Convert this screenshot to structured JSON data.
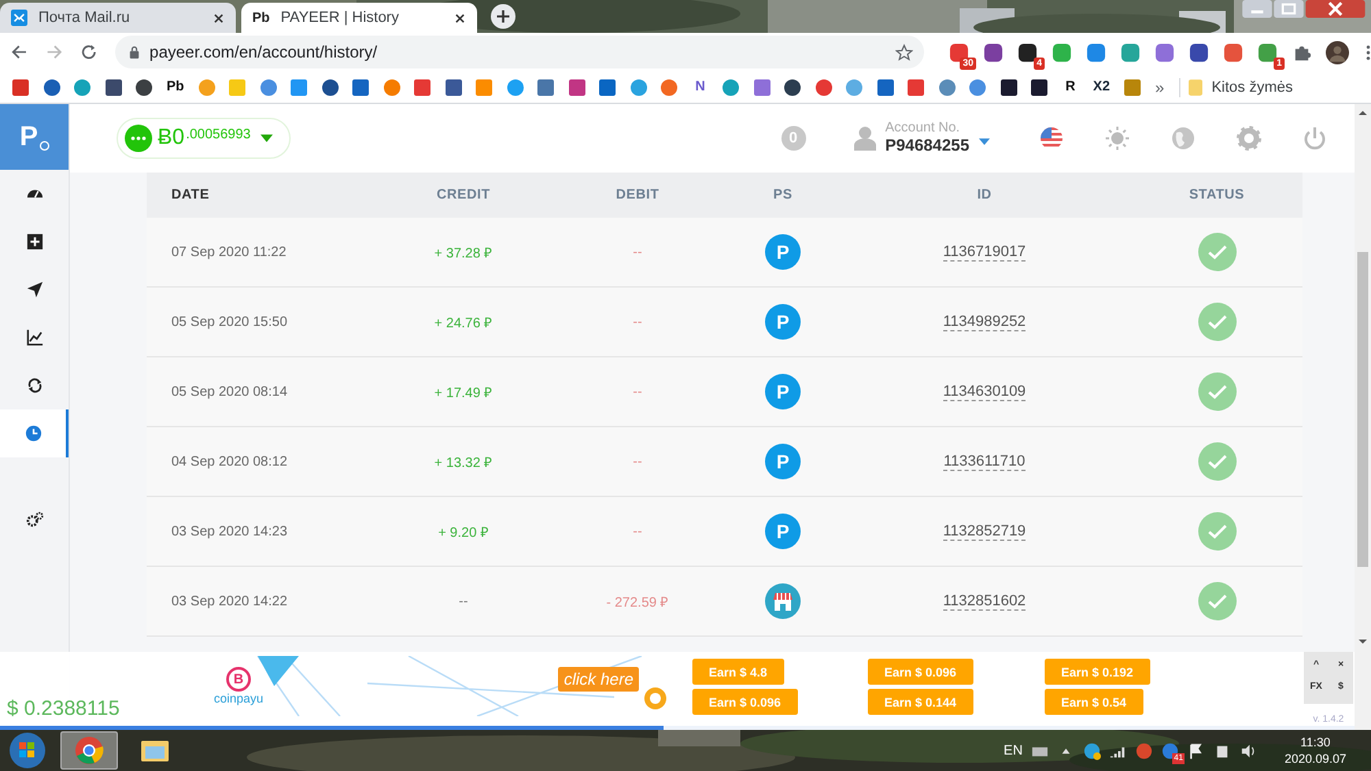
{
  "browser": {
    "tabs": [
      {
        "title": "Почта Mail.ru",
        "selected": false
      },
      {
        "title": "PAYEER | History",
        "icon_text": "Pb",
        "selected": true
      }
    ],
    "url": "payeer.com/en/account/history/",
    "extensions": [
      {
        "color": "#e53935",
        "badge": "30"
      },
      {
        "color": "#7b3fa0"
      },
      {
        "color": "#222222",
        "badge": "4"
      },
      {
        "color": "#2eb34a"
      },
      {
        "color": "#1e88e5"
      },
      {
        "color": "#26a69a"
      },
      {
        "color": "#8e6fd8"
      },
      {
        "color": "#3949ab"
      },
      {
        "color": "#e5533d"
      },
      {
        "color": "#43a047",
        "badge": "1"
      }
    ],
    "bookmarks": [
      {
        "color": "#d93025",
        "kind": "square"
      },
      {
        "color": "#1a5fb4",
        "kind": "circle"
      },
      {
        "color": "#16a3b8",
        "kind": "circle"
      },
      {
        "color": "#3c4a6b",
        "kind": "square"
      },
      {
        "color": "#3c4043",
        "kind": "circle"
      },
      {
        "color": "#111111",
        "kind": "text",
        "text": "Pb"
      },
      {
        "color": "#f4a11d",
        "kind": "circle"
      },
      {
        "color": "#f6c915",
        "kind": "square"
      },
      {
        "color": "#4a8fe0",
        "kind": "circle"
      },
      {
        "color": "#2196f3",
        "kind": "square"
      },
      {
        "color": "#1d4f91",
        "kind": "circle"
      },
      {
        "color": "#1565c0",
        "kind": "square"
      },
      {
        "color": "#f57c00",
        "kind": "circle"
      },
      {
        "color": "#e53935",
        "kind": "square"
      },
      {
        "color": "#3b5998",
        "kind": "square"
      },
      {
        "color": "#fb8c00",
        "kind": "square"
      },
      {
        "color": "#1da1f2",
        "kind": "circle"
      },
      {
        "color": "#4a76a8",
        "kind": "square"
      },
      {
        "color": "#c13584",
        "kind": "square"
      },
      {
        "color": "#0a66c2",
        "kind": "square"
      },
      {
        "color": "#2aa3df",
        "kind": "circle"
      },
      {
        "color": "#f26822",
        "kind": "circle"
      },
      {
        "color": "#6a5acd",
        "kind": "text",
        "text": "N"
      },
      {
        "color": "#16a3b8",
        "kind": "circle"
      },
      {
        "color": "#8e6fd8",
        "kind": "square"
      },
      {
        "color": "#2c3e50",
        "kind": "circle"
      },
      {
        "color": "#e53935",
        "kind": "circle"
      },
      {
        "color": "#5dade2",
        "kind": "circle"
      },
      {
        "color": "#1565c0",
        "kind": "square"
      },
      {
        "color": "#e53935",
        "kind": "square"
      },
      {
        "color": "#5b8db8",
        "kind": "circle"
      },
      {
        "color": "#4a8fe0",
        "kind": "circle"
      },
      {
        "color": "#1b1b2f",
        "kind": "square"
      },
      {
        "color": "#1b1b2f",
        "kind": "square"
      },
      {
        "color": "#111111",
        "kind": "text",
        "text": "R"
      },
      {
        "color": "#1b2838",
        "kind": "text",
        "text": "X2"
      },
      {
        "color": "#b8860b",
        "kind": "square"
      }
    ],
    "bookmarks_more": "»",
    "other_bookmarks": "Kitos žymės"
  },
  "sidebar": {
    "logo": "P",
    "items": [
      {
        "kind": "dashboard",
        "selected": false
      },
      {
        "kind": "add",
        "selected": false
      },
      {
        "kind": "send",
        "selected": false
      },
      {
        "kind": "chart",
        "selected": false
      },
      {
        "kind": "exchange",
        "selected": false
      },
      {
        "kind": "history",
        "selected": true
      },
      {
        "kind": "settings",
        "selected": false
      }
    ]
  },
  "header": {
    "balance_main": "Ƀ0",
    "balance_fraction": ".00056993",
    "notifications": "0",
    "account_label": "Account No.",
    "account_number": "P94684255"
  },
  "table": {
    "columns": [
      "DATE",
      "CREDIT",
      "DEBIT",
      "PS",
      "ID",
      "STATUS"
    ],
    "rows": [
      {
        "date": "07 Sep 2020 11:22",
        "credit": "+ 37.28 ₽",
        "debit": "--",
        "ps": {
          "kind": "payeer",
          "label": "P"
        },
        "id": "1136719017",
        "status": {
          "kind": "success"
        }
      },
      {
        "date": "05 Sep 2020 15:50",
        "credit": "+ 24.76 ₽",
        "debit": "--",
        "ps": {
          "kind": "payeer",
          "label": "P"
        },
        "id": "1134989252",
        "status": {
          "kind": "success"
        }
      },
      {
        "date": "05 Sep 2020 08:14",
        "credit": "+ 17.49 ₽",
        "debit": "--",
        "ps": {
          "kind": "payeer",
          "label": "P"
        },
        "id": "1134630109",
        "status": {
          "kind": "success"
        }
      },
      {
        "date": "04 Sep 2020 08:12",
        "credit": "+ 13.32 ₽",
        "debit": "--",
        "ps": {
          "kind": "payeer",
          "label": "P"
        },
        "id": "1133611710",
        "status": {
          "kind": "success"
        }
      },
      {
        "date": "03 Sep 2020 14:23",
        "credit": "+ 9.20 ₽",
        "debit": "--",
        "ps": {
          "kind": "payeer",
          "label": "P"
        },
        "id": "1132852719",
        "status": {
          "kind": "success"
        }
      },
      {
        "date": "03 Sep 2020 14:22",
        "credit": "--",
        "debit": "- 272.59 ₽",
        "ps": {
          "kind": "shop"
        },
        "id": "1132851602",
        "status": {
          "kind": "success"
        }
      }
    ]
  },
  "overlay": {
    "usd_balance": "$ 0.2388115",
    "ad": {
      "brand": "coinpayu",
      "coin": "B",
      "cta": "click here"
    },
    "earn_buttons": [
      "Earn $ 4.8",
      "Earn $ 0.096",
      "Earn $ 0.096",
      "Earn $ 0.144",
      "Earn $ 0.192",
      "Earn $ 0.54"
    ],
    "widget_buttons": [
      "^",
      "×",
      "FX",
      "$"
    ],
    "version": "v. 1.4.2",
    "progress": {
      "level": 0.49
    }
  },
  "taskbar": {
    "apps": [
      {
        "kind": "chrome",
        "selected": true
      },
      {
        "kind": "folder",
        "selected": false
      }
    ],
    "language": "EN",
    "tray_badge": "41",
    "time": "11:30",
    "date": "2020.09.07"
  }
}
